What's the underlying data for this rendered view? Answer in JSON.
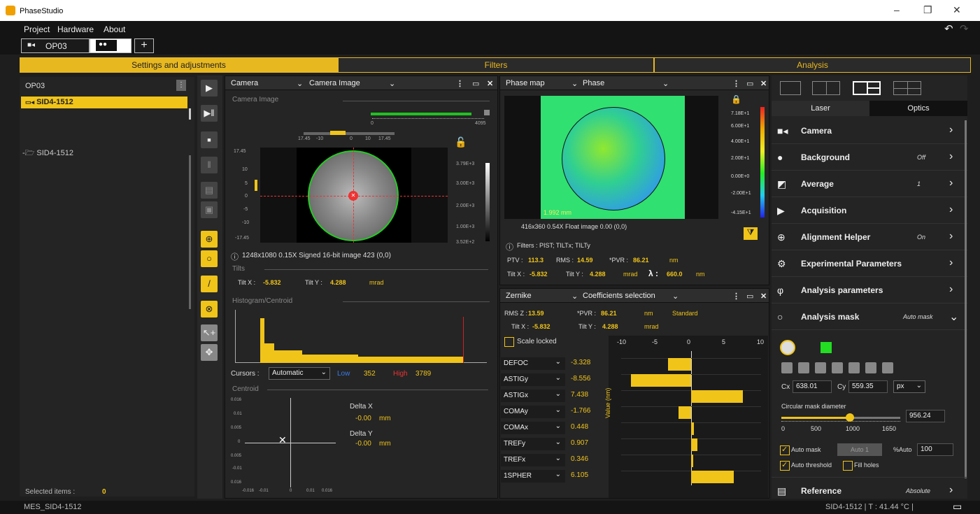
{
  "app": {
    "title": "PhaseStudio"
  },
  "menu": [
    "Project",
    "Hardware",
    "About"
  ],
  "doc_tabs": {
    "op": "OP03",
    "add": "+"
  },
  "sections": [
    "Settings and adjustments",
    "Filters",
    "Analysis"
  ],
  "left": {
    "title": "OP03",
    "selected_item": "SID4-1512",
    "tree_item": "SID4-1512",
    "selected_label": "Selected items :",
    "selected_count": "0"
  },
  "camera": {
    "header": "Camera",
    "view": "Camera Image",
    "section": "Camera Image",
    "range_min": "0",
    "range_max": "4095",
    "ruler": [
      "17.45",
      "-10",
      "0",
      "10",
      "17.45"
    ],
    "yaxis": [
      "17.45",
      "10",
      "5",
      "0",
      "-5",
      "-10",
      "-17.45"
    ],
    "scale": [
      "3.79E+3",
      "3.00E+3",
      "2.00E+3",
      "1.00E+3",
      "3.52E+2"
    ],
    "info": "1248x1080 0.15X Signed 16-bit image 423  (0,0)",
    "tilts_label": "Tilts",
    "tilt_x_label": "Tilt X :",
    "tilt_x": "-5.832",
    "tilt_y_label": "Tilt Y :",
    "tilt_y": "4.288",
    "tilt_unit": "mrad",
    "histogram_label": "Histogram/Centroid",
    "cursors_label": "Cursors :",
    "cursors_value": "Automatic",
    "low_label": "Low",
    "low": "352",
    "high_label": "High",
    "high": "3789",
    "centroid_label": "Centroid",
    "centroid_y": [
      "0.016",
      "0.01",
      "0.005",
      "0",
      "0.005",
      "-0.01",
      "0.016"
    ],
    "centroid_x": [
      "-0.016",
      "-0.01",
      "0",
      "0.01",
      "0.016"
    ],
    "delta_x_label": "Delta X",
    "delta_x": "-0.00",
    "delta_y_label": "Delta Y",
    "delta_y": "-0.00",
    "delta_unit": "mm"
  },
  "phase": {
    "header": "Phase map",
    "view": "Phase",
    "scale": [
      "7.18E+1",
      "6.00E+1",
      "4.00E+1",
      "2.00E+1",
      "0.00E+0",
      "-2.00E+1",
      "-4.15E+1"
    ],
    "pupil": "1.992 mm",
    "info": "416x360 0.54X Float image 0.00  (0,0)",
    "filters": "Filters : PIST; TILTx; TILTy",
    "ptv_label": "PTV :",
    "ptv": "113.3",
    "rms_label": "RMS :",
    "rms": "14.59",
    "pvr_label": "*PVR :",
    "pvr": "86.21",
    "unit": "nm",
    "tiltx_label": "Tilt X :",
    "tiltx": "-5.832",
    "tilty_label": "Tilt Y :",
    "tilty": "4.288",
    "tilt_unit": "mrad",
    "lambda_label": "λ :",
    "lambda": "660.0",
    "lambda_unit": "nm"
  },
  "zernike": {
    "header": "Zernike",
    "view": "Coefficients selection",
    "rmsz_label": "RMS Z :",
    "rmsz": "13.59",
    "pvr_label": "*PVR :",
    "pvr": "86.21",
    "unit": "nm",
    "standard": "Standard",
    "tiltx_label": "Tilt X :",
    "tiltx": "-5.832",
    "tilty_label": "Tilt Y :",
    "tilty": "4.288",
    "tilt_unit": "mrad",
    "scale_locked": "Scale locked",
    "axis_label": "Value (nm)",
    "ticks": [
      "-10",
      "-5",
      "0",
      "5",
      "10"
    ]
  },
  "chart_data": {
    "type": "bar",
    "categories": [
      "DEFOC",
      "ASTIGy",
      "ASTIGx",
      "COMAy",
      "COMAx",
      "TREFy",
      "TREFx",
      "1SPHER"
    ],
    "values": [
      -3.328,
      -8.556,
      7.438,
      -1.766,
      0.448,
      0.907,
      0.346,
      6.105
    ],
    "ylabel": "Value (nm)",
    "xlim": [
      -10,
      10
    ],
    "orientation": "horizontal",
    "color": "#f0c419"
  },
  "right": {
    "tabs": [
      "Laser",
      "Optics"
    ],
    "rows": [
      {
        "icon": "camera-icon",
        "label": "Camera",
        "status": ""
      },
      {
        "icon": "background-icon",
        "label": "Background",
        "status": "Off"
      },
      {
        "icon": "average-icon",
        "label": "Average",
        "status": "1"
      },
      {
        "icon": "acquisition-icon",
        "label": "Acquisition",
        "status": ""
      },
      {
        "icon": "alignment-icon",
        "label": "Alignment Helper",
        "status": "On"
      },
      {
        "icon": "experiment-icon",
        "label": "Experimental Parameters",
        "status": ""
      },
      {
        "icon": "phi-icon",
        "label": "Analysis parameters",
        "status": ""
      },
      {
        "icon": "mask-icon",
        "label": "Analysis mask",
        "status": "Auto mask"
      }
    ],
    "cx_label": "Cx",
    "cx": "638.01",
    "cy_label": "Cy",
    "cy": "559.35",
    "unit": "px",
    "diameter_label": "Circular mask diameter",
    "diameter": "956.24",
    "slider_ticks": [
      "0",
      "500",
      "1000",
      "1650"
    ],
    "auto_mask": "Auto mask",
    "auto_btn": "Auto 1",
    "pct_auto_label": "%Auto",
    "pct_auto": "100",
    "auto_threshold": "Auto threshold",
    "fill_holes": "Fill holes",
    "reference_label": "Reference",
    "reference_status": "Absolute"
  },
  "status": {
    "left": "MES_SID4-1512",
    "right": "SID4-1512  |  T : 41.44 °C  |"
  }
}
